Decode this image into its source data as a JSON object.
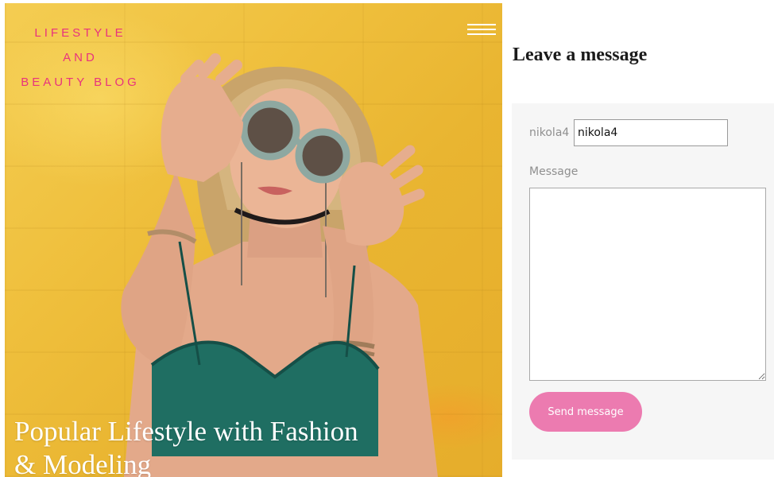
{
  "hero": {
    "logo_lines": [
      "LIFESTYLE",
      "AND",
      "BEAUTY BLOG"
    ],
    "title_line1": "Popular Lifestyle with Fashion",
    "title_line2": "& Modeling"
  },
  "menu": {
    "icon": "hamburger-icon"
  },
  "contact": {
    "title": "Leave a message",
    "user_label": "nikola4",
    "user_value": "nikola4",
    "message_label": "Message",
    "message_value": "",
    "send_label": "Send message"
  },
  "colors": {
    "accent_pink": "#e8337d",
    "button_pink": "#ec7bb0",
    "hero_yellow": "#efbf3c"
  }
}
